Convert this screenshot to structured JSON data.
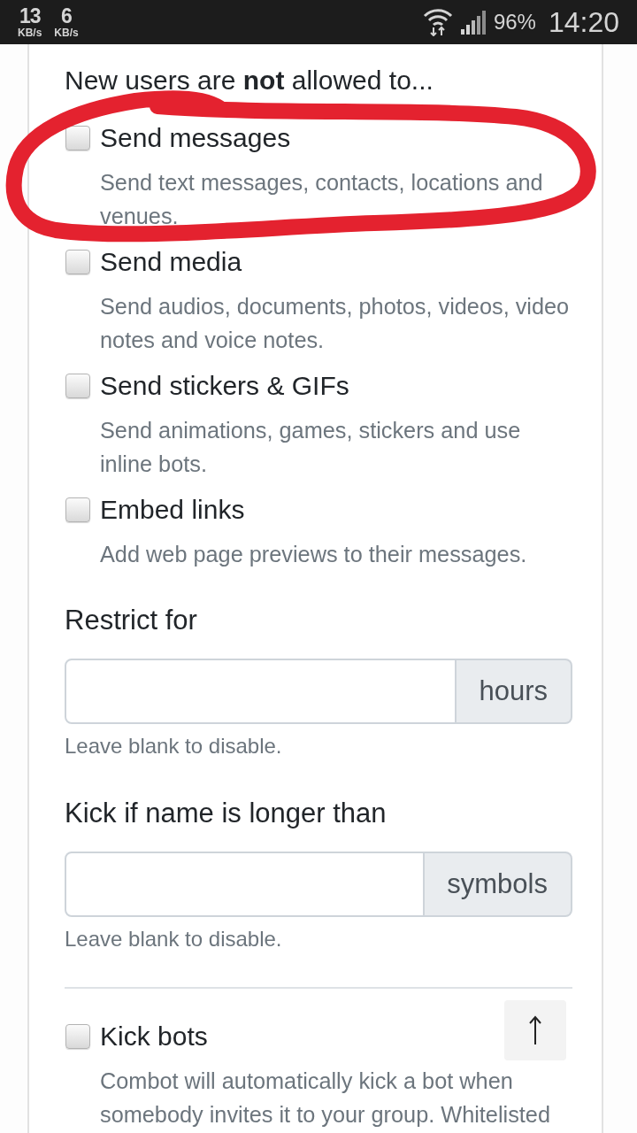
{
  "status_bar": {
    "speeds": [
      {
        "value": "13",
        "unit": "KB/s"
      },
      {
        "value": "6",
        "unit": "KB/s"
      }
    ],
    "battery": "96%",
    "time": "14:20"
  },
  "permissions": {
    "heading": "New users are **not** allowed to...",
    "options": [
      {
        "label": "Send messages",
        "description": "Send text messages, contacts, locations and venues.",
        "checked": false,
        "circled": true
      },
      {
        "label": "Send media",
        "description": "Send audios, documents, photos, videos, video notes and voice notes.",
        "checked": false,
        "circled": false
      },
      {
        "label": "Send stickers & GIFs",
        "description": "Send animations, games, stickers and use inline bots.",
        "checked": false,
        "circled": false
      },
      {
        "label": "Embed links",
        "description": "Add web page previews to their messages.",
        "checked": false,
        "circled": false
      }
    ]
  },
  "limits": [
    {
      "label": "Restrict for",
      "addon": "hours",
      "help": "Leave blank to disable."
    },
    {
      "label": "Kick if name is longer than",
      "addon": "symbols",
      "help": "Leave blank to disable."
    }
  ],
  "kick_bots": {
    "label": "Kick bots",
    "description": "Combot will automatically kick a bot when somebody invites it to your group. Whitelisted",
    "checked": false
  }
}
